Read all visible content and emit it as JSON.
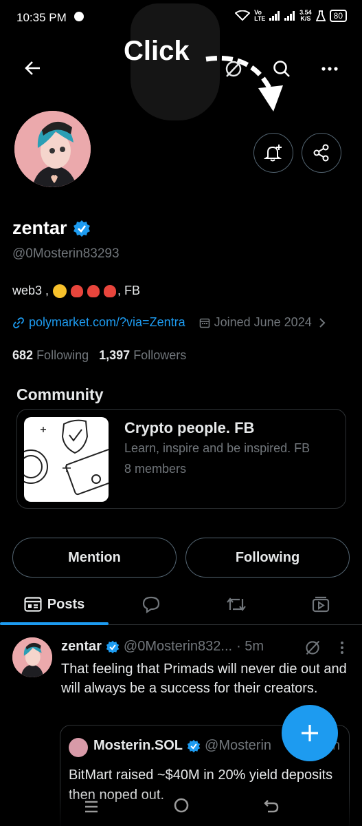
{
  "status_bar": {
    "time": "10:35 PM",
    "network": "Vo LTE",
    "speed_value": "3.54",
    "speed_unit": "K/S",
    "battery": "80"
  },
  "overlay": {
    "click_label": "Click"
  },
  "profile": {
    "display_name": "zentar",
    "handle": "@0Mosterin83293",
    "bio_prefix": "web3 ,",
    "bio_suffix": ", FB",
    "link": "polymarket.com/?via=Zentra",
    "joined": "Joined June 2024",
    "following_count": "682",
    "following_label": "Following",
    "followers_count": "1,397",
    "followers_label": "Followers"
  },
  "community": {
    "section_title": "Community",
    "name": "Crypto people. FB",
    "description": "Learn, inspire and be inspired. FB",
    "members": "8 members"
  },
  "actions": {
    "mention_label": "Mention",
    "following_label": "Following"
  },
  "tabs": {
    "posts_label": "Posts"
  },
  "post": {
    "author": "zentar",
    "handle": "@0Mosterin832...",
    "time": "· 5m",
    "text": "That feeling that Primads will never die out and will always be a success for their creators."
  },
  "quote": {
    "author": "Mosterin.SOL",
    "handle": "@Mosterin",
    "handle_tail": "h",
    "text": "BitMart raised ~$40M in 20% yield deposits then noped out."
  },
  "colors": {
    "accent": "#1d9bf0",
    "background": "#000000",
    "secondary_text": "#71767b",
    "border": "#2f3336"
  },
  "icons": [
    "back-arrow-icon",
    "grok-icon",
    "search-icon",
    "more-icon",
    "bell-plus-icon",
    "share-icon",
    "verified-icon",
    "link-icon",
    "calendar-icon",
    "chevron-right-icon",
    "posts-icon",
    "replies-icon",
    "retweet-icon",
    "media-icon",
    "plus-icon"
  ]
}
